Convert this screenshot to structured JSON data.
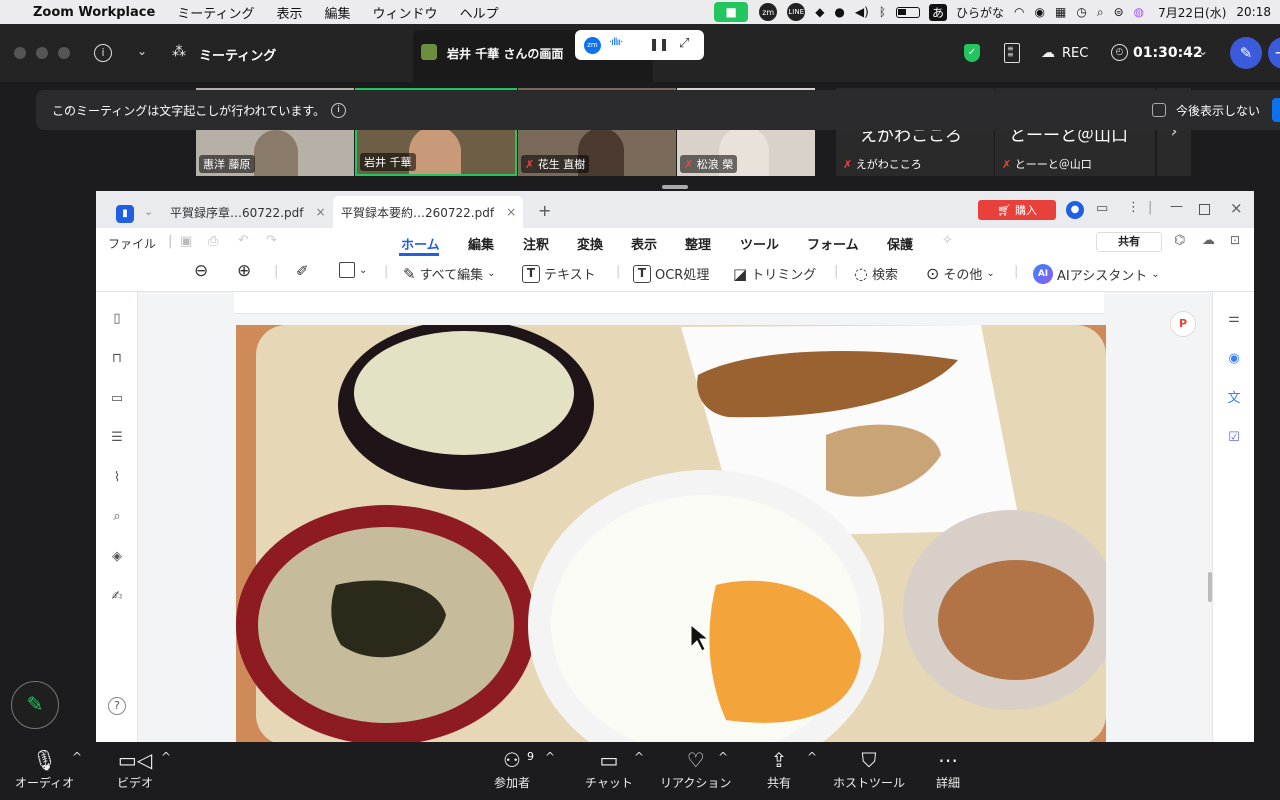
{
  "menubar": {
    "app_name": "Zoom Workplace",
    "items": [
      "ミーティング",
      "表示",
      "編集",
      "ウィンドウ",
      "ヘルプ"
    ],
    "input_mode": "あ",
    "input_label": "ひらがな",
    "date": "7月22日(水)",
    "time": "20:18"
  },
  "zoom_header": {
    "meeting_label": "ミーティング",
    "share_title": "岩井 千華 さんの画面",
    "rec_label": "REC",
    "timer": "01:30:42"
  },
  "banner": {
    "message": "このミーティングは文字起こしが行われています。",
    "checkbox_label": "今後表示しない"
  },
  "participants": [
    {
      "name": "惠洋 藤原",
      "muted": false
    },
    {
      "name": "岩井 千華",
      "muted": false
    },
    {
      "name": "花生 直樹",
      "muted": true
    },
    {
      "name": "松浪 榮",
      "muted": true
    },
    {
      "name": "えがわこころ",
      "muted": true,
      "big_text": "えがわこころ"
    },
    {
      "name": "とーーと＠山口",
      "muted": true,
      "big_text": "とーーと＠山口"
    }
  ],
  "pdf": {
    "tabs": [
      {
        "label": "平賀録序章…60722.pdf",
        "active": false
      },
      {
        "label": "平賀録本要約…260722.pdf",
        "active": true
      }
    ],
    "buy_label": "購入",
    "file_menu": "ファイル",
    "menu": [
      "ホーム",
      "編集",
      "注釈",
      "変換",
      "表示",
      "整理",
      "ツール",
      "フォーム",
      "保護"
    ],
    "active_menu": "ホーム",
    "share_label": "共有",
    "tools": {
      "edit_all": "すべて編集",
      "text": "テキスト",
      "ocr": "OCR処理",
      "trim": "トリミング",
      "search": "検索",
      "more": "その他",
      "ai": "AIアシスタント"
    }
  },
  "bottom": {
    "audio": "オーディオ",
    "video": "ビデオ",
    "participants": "参加者",
    "participant_count": "9",
    "chat": "チャット",
    "reaction": "リアクション",
    "share": "共有",
    "host_tools": "ホストツール",
    "more": "詳細"
  },
  "colors": {
    "zoom_bg": "#242424",
    "accent_blue": "#0e72ed",
    "green": "#22c55e",
    "pdf_active": "#1f5fe0",
    "buy_red": "#e8403a"
  }
}
